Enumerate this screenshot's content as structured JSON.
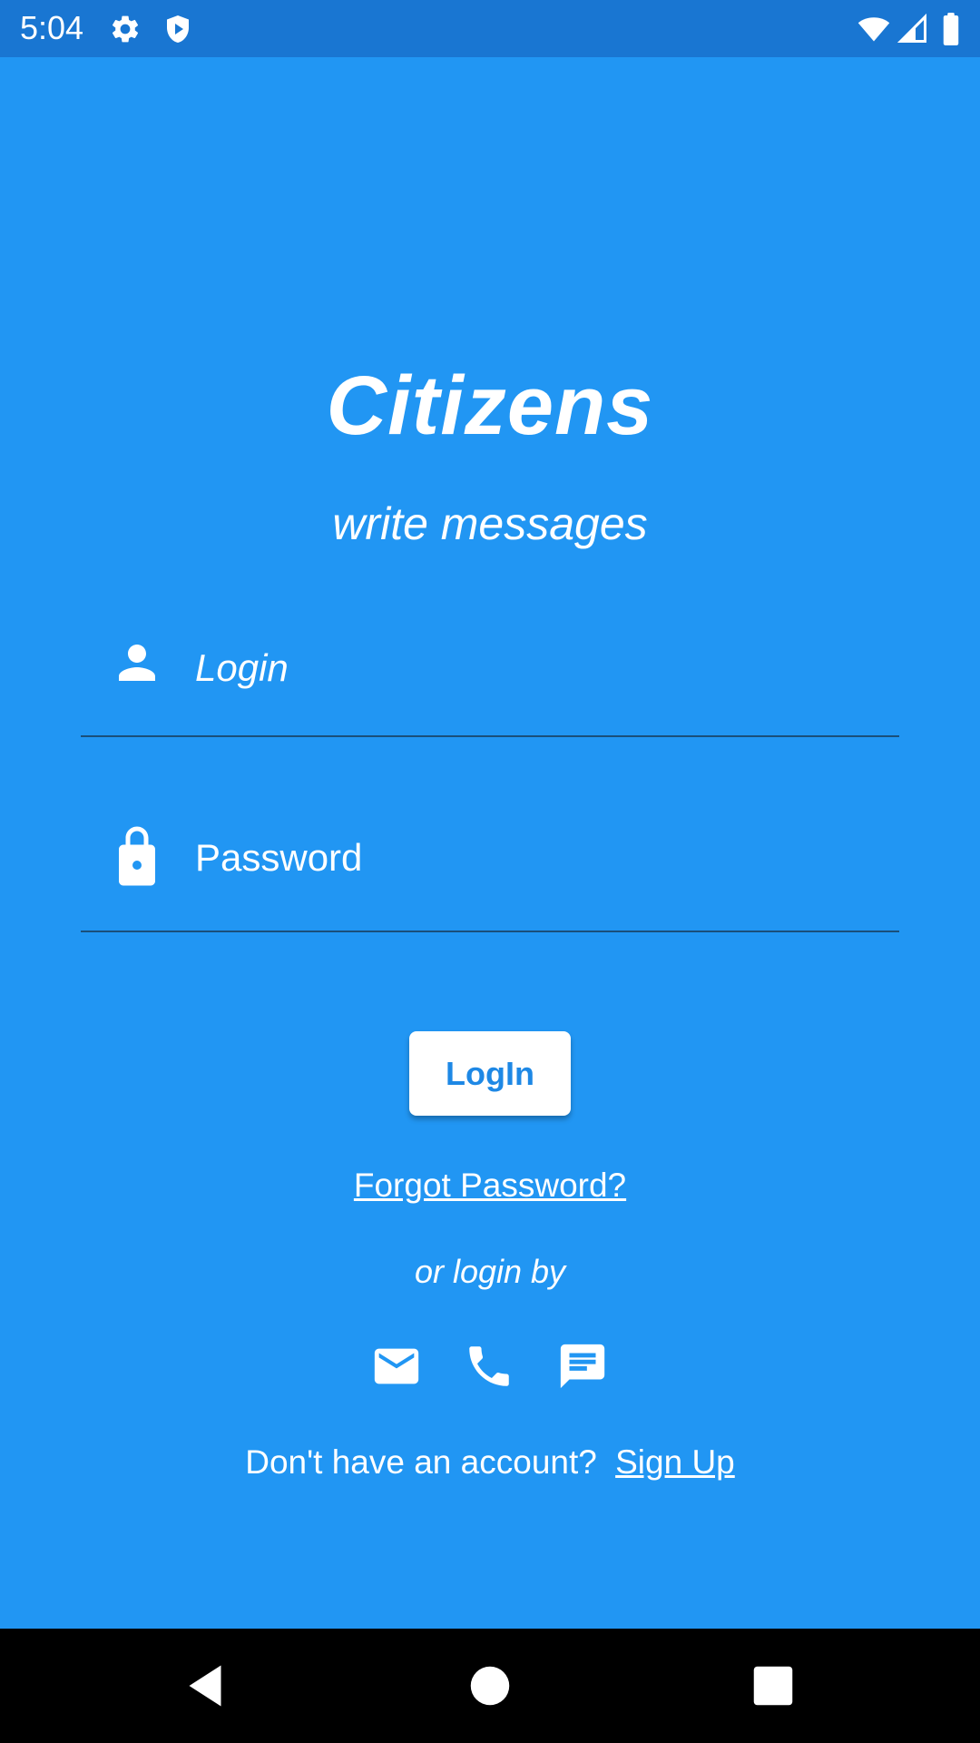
{
  "status_bar": {
    "time": "5:04",
    "icons": [
      "gear-icon",
      "shield-play-icon",
      "wifi-icon",
      "signal-icon",
      "battery-icon"
    ]
  },
  "app": {
    "title": "Citizens",
    "subtitle": "write messages"
  },
  "form": {
    "login": {
      "placeholder": "Login",
      "value": "",
      "icon": "person-icon"
    },
    "password": {
      "placeholder": "Password",
      "value": "",
      "icon": "lock-icon"
    },
    "login_button": "LogIn",
    "forgot_password": "Forgot Password?",
    "or_login_by": "or login by",
    "alt_methods": [
      "email-icon",
      "phone-icon",
      "message-icon"
    ],
    "no_account": "Don't have an account?",
    "sign_up": "Sign Up"
  },
  "nav_bar": {
    "buttons": [
      "back-icon",
      "home-icon",
      "recents-icon"
    ]
  },
  "colors": {
    "background": "#2196F3",
    "status_bar": "#1976D2",
    "button_text": "#1E88E5",
    "nav_bar": "#000000"
  }
}
